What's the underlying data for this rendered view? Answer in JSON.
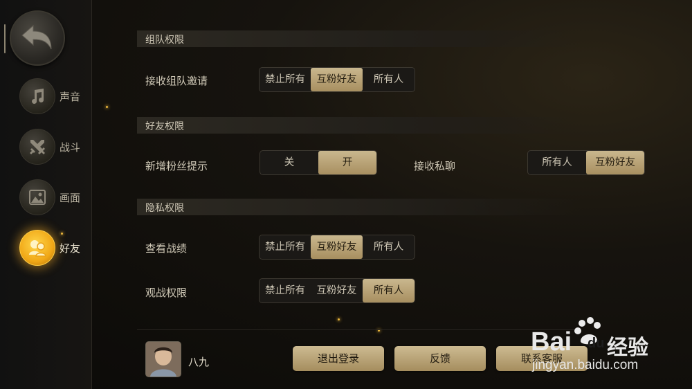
{
  "sidebar": {
    "items": [
      {
        "label": "声音",
        "icon": "music-note-icon"
      },
      {
        "label": "战斗",
        "icon": "crossed-swords-icon"
      },
      {
        "label": "画面",
        "icon": "picture-icon"
      },
      {
        "label": "好友",
        "icon": "friends-icon",
        "active": true
      }
    ]
  },
  "sections": {
    "team": {
      "title": "组队权限",
      "invite": {
        "label": "接收组队邀请",
        "options": [
          "禁止所有",
          "互粉好友",
          "所有人"
        ],
        "selected": "互粉好友"
      }
    },
    "friends": {
      "title": "好友权限",
      "new_fans": {
        "label": "新增粉丝提示",
        "options": [
          "关",
          "开"
        ],
        "selected": "开"
      },
      "private_msg": {
        "label": "接收私聊",
        "options": [
          "所有人",
          "互粉好友"
        ],
        "selected": "互粉好友"
      }
    },
    "privacy": {
      "title": "隐私权限",
      "view_record": {
        "label": "查看战绩",
        "options": [
          "禁止所有",
          "互粉好友",
          "所有人"
        ],
        "selected": "互粉好友"
      },
      "spectate": {
        "label": "观战权限",
        "options": [
          "禁止所有",
          "互粉好友",
          "所有人"
        ],
        "selected": "所有人"
      }
    }
  },
  "footer": {
    "username": "八九",
    "logout": "退出登录",
    "feedback": "反馈",
    "contact": "联系客服"
  },
  "watermark": {
    "brand": "Bai",
    "brand2": "du",
    "jingyan": "经验",
    "url": "jingyan.baidu.com"
  },
  "colors": {
    "accent_gold": "#c3b084",
    "active_orange": "#f1a817",
    "background": "#0d0c0a"
  }
}
